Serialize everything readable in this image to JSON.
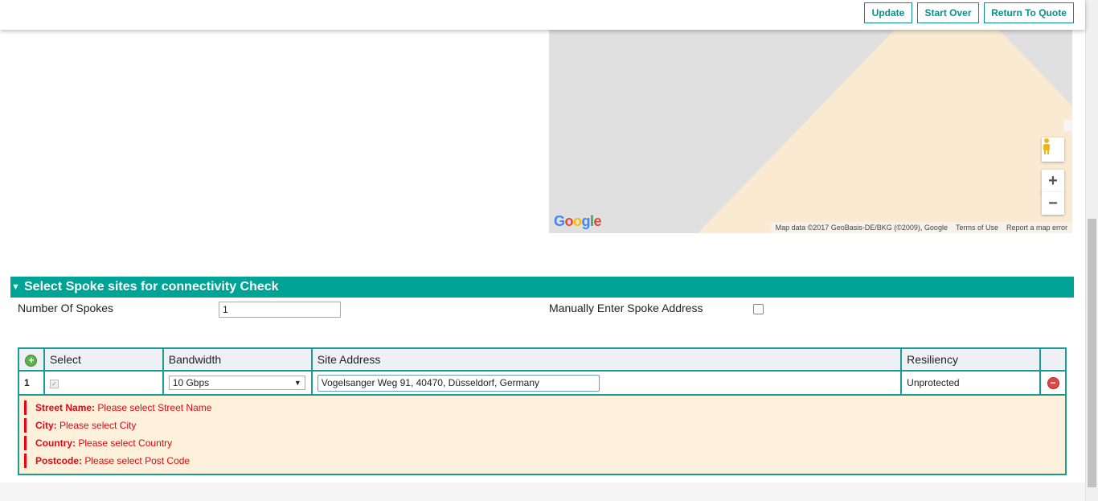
{
  "toolbar": {
    "update_label": "Update",
    "start_over_label": "Start Over",
    "return_label": "Return To Quote"
  },
  "map": {
    "logo": "Google",
    "attribution": "Map data ©2017 GeoBasis-DE/BKG (©2009), Google",
    "terms": "Terms of Use",
    "report": "Report a map error",
    "zoom_in": "+",
    "zoom_out": "−",
    "colors": {
      "land": "#e0e0e0",
      "area": "#f9ead1"
    }
  },
  "section": {
    "title": "Select Spoke sites for connectivity Check",
    "spokes_label": "Number Of Spokes",
    "spokes_value": "1",
    "manual_label": "Manually Enter Spoke Address"
  },
  "table": {
    "headers": [
      "Select",
      "Bandwidth",
      "Site Address",
      "Resiliency"
    ],
    "rows": [
      {
        "num": "1",
        "bandwidth": "10 Gbps",
        "address": "Vogelsanger Weg 91, 40470, Düsseldorf, Germany",
        "resiliency": "Unprotected"
      }
    ]
  },
  "errors": [
    {
      "field": "Street Name:",
      "message": "Please select Street Name"
    },
    {
      "field": "City:",
      "message": "Please select City"
    },
    {
      "field": "Country:",
      "message": "Please select Country"
    },
    {
      "field": "Postcode:",
      "message": "Please select Post Code"
    }
  ],
  "colors": {
    "accent": "#00a496",
    "error": "#e01111"
  }
}
